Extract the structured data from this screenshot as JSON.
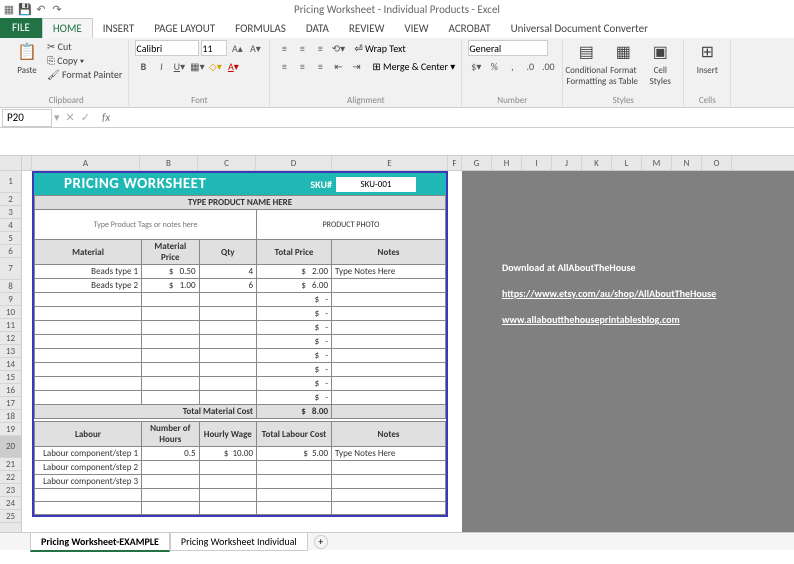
{
  "titlebar": {
    "title": "Pricing Worksheet - Individual Products - Excel"
  },
  "tabs": {
    "file": "FILE",
    "items": [
      "HOME",
      "INSERT",
      "PAGE LAYOUT",
      "FORMULAS",
      "DATA",
      "REVIEW",
      "VIEW",
      "ACROBAT",
      "Universal Document Converter"
    ],
    "active": 0
  },
  "ribbon": {
    "clipboard": {
      "paste": "Paste",
      "cut": "Cut",
      "copy": "Copy",
      "fmtpaint": "Format Painter",
      "label": "Clipboard"
    },
    "font": {
      "name": "Calibri",
      "size": "11",
      "label": "Font"
    },
    "alignment": {
      "wrap": "Wrap Text",
      "merge": "Merge & Center",
      "label": "Alignment"
    },
    "number": {
      "fmt": "General",
      "label": "Number"
    },
    "styles": {
      "cond": "Conditional Formatting",
      "table": "Format as Table",
      "cell": "Cell Styles",
      "label": "Styles"
    },
    "cells": {
      "insert": "Insert",
      "label": "Cells"
    }
  },
  "formulabar": {
    "namebox": "P20"
  },
  "col_headers": [
    "A",
    "B",
    "C",
    "D",
    "E",
    "F",
    "G",
    "H",
    "I",
    "J",
    "K",
    "L",
    "M",
    "N",
    "O"
  ],
  "row_headers": [
    "1",
    "2",
    "3",
    "4",
    "5",
    "6",
    "7",
    "8",
    "9",
    "10",
    "11",
    "12",
    "13",
    "14",
    "15",
    "16",
    "17",
    "18",
    "19",
    "20",
    "21",
    "22",
    "23",
    "24",
    "25"
  ],
  "worksheet": {
    "title": "PRICING WORKSHEET",
    "sku_label": "SKU#",
    "sku_value": "SKU-001",
    "product_name": "TYPE PRODUCT NAME HERE",
    "tags_placeholder": "Type Product Tags or notes here",
    "photo_placeholder": "PRODUCT PHOTO",
    "material_headers": [
      "Material",
      "Material Price",
      "Qty",
      "Total Price",
      "Notes"
    ],
    "materials": [
      {
        "name": "Beads type 1",
        "price": "0.50",
        "qty": "4",
        "total": "2.00",
        "notes": "Type Notes Here"
      },
      {
        "name": "Beads type 2",
        "price": "1.00",
        "qty": "6",
        "total": "6.00",
        "notes": ""
      }
    ],
    "empty_totals": [
      "-",
      "-",
      "-",
      "-",
      "-",
      "-",
      "-",
      "-"
    ],
    "total_material_label": "Total Material Cost",
    "total_material_value": "8.00",
    "labour_headers": [
      "Labour",
      "Number of Hours",
      "Hourly Wage",
      "Total Labour Cost",
      "Notes"
    ],
    "labour": [
      {
        "name": "Labour component/step 1",
        "hours": "0.5",
        "wage": "10.00",
        "total": "5.00",
        "notes": "Type Notes Here"
      },
      {
        "name": "Labour component/step 2",
        "hours": "",
        "wage": "",
        "total": "",
        "notes": ""
      },
      {
        "name": "Labour component/step 3",
        "hours": "",
        "wage": "",
        "total": "",
        "notes": ""
      }
    ],
    "currency": "$"
  },
  "overlay": {
    "line1": "Download at AllAboutTheHouse",
    "line2": "https://www.etsy.com/au/shop/AllAboutTheHouse",
    "line3": "www.allaboutthehouseprintablesblog.com"
  },
  "sheet_tabs": {
    "items": [
      "Pricing Worksheet-EXAMPLE",
      "Pricing Worksheet Individual"
    ],
    "active": 0
  }
}
